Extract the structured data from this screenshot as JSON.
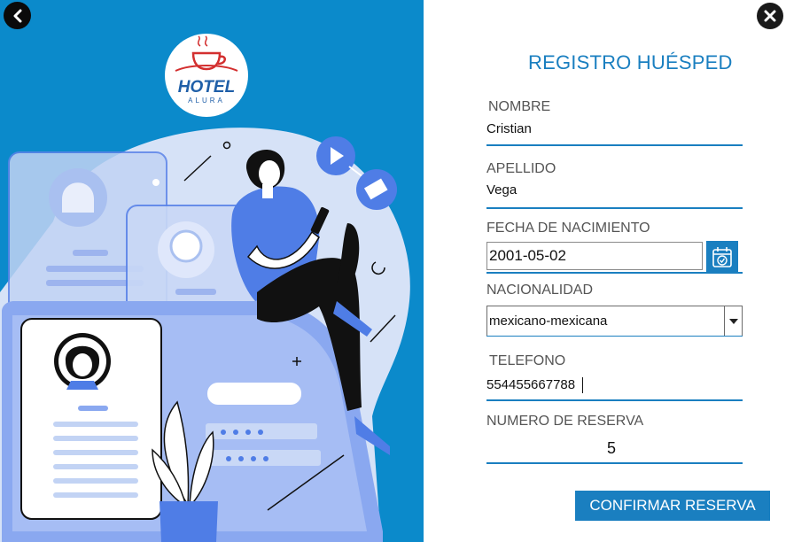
{
  "logo": {
    "line1": "HOTEL",
    "line2": "ALURA"
  },
  "form": {
    "title": "REGISTRO HUÉSPED",
    "nombre_label": "NOMBRE",
    "nombre_value": "Cristian",
    "apellido_label": "APELLIDO",
    "apellido_value": "Vega",
    "fecha_label": "FECHA DE NACIMIENTO",
    "fecha_value": "2001-05-02",
    "nacionalidad_label": "NACIONALIDAD",
    "nacionalidad_value": "mexicano-mexicana",
    "telefono_label": "TELEFONO",
    "telefono_value": "554455667788",
    "reserva_label": "NUMERO DE RESERVA",
    "reserva_value": "5",
    "confirm_label": "CONFIRMAR RESERVA"
  },
  "icons": {
    "back": "arrow-left-icon",
    "close": "close-icon",
    "calendar": "calendar-icon",
    "dropdown": "chevron-down-icon"
  },
  "colors": {
    "left_panel_bg": "#0b8acb",
    "accent": "#1a7fc0",
    "illustration_blue": "#4f7de6"
  }
}
